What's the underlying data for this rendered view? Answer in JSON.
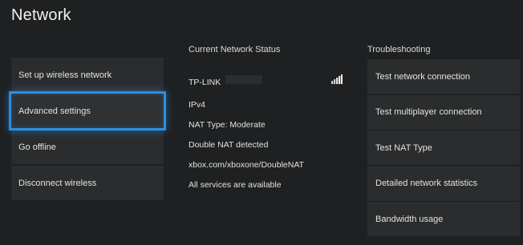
{
  "page": {
    "title": "Network"
  },
  "left_menu": [
    {
      "label": "Set up wireless network"
    },
    {
      "label": "Advanced settings",
      "selected": true
    },
    {
      "label": "Go offline"
    },
    {
      "label": "Disconnect wireless"
    }
  ],
  "status": {
    "header": "Current Network Status",
    "network_name": "TP-LINK",
    "signal_icon": "wifi-signal-bars-icon",
    "lines": [
      "IPv4",
      "NAT Type: Moderate",
      "Double NAT detected",
      "xbox.com/xboxone/DoubleNAT",
      "All services are available"
    ]
  },
  "troubleshooting": {
    "header": "Troubleshooting",
    "items": [
      {
        "label": "Test network connection"
      },
      {
        "label": "Test multiplayer connection"
      },
      {
        "label": "Test NAT Type"
      },
      {
        "label": "Detailed network statistics"
      },
      {
        "label": "Bandwidth usage"
      }
    ]
  },
  "colors": {
    "background": "#1f2021",
    "tile": "#2b2c2d",
    "focus": "#2a8fe0"
  }
}
